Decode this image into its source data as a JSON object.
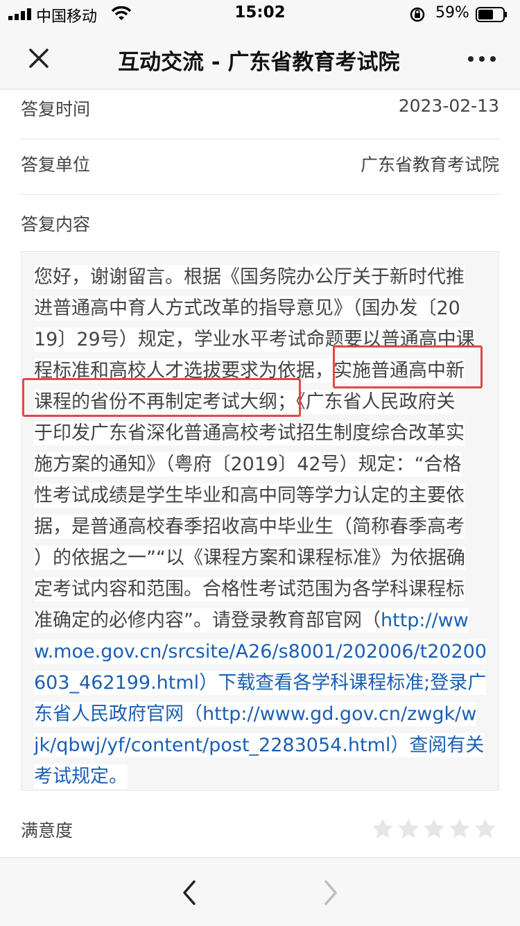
{
  "status_bar": {
    "carrier": "中国移动",
    "time": "15:02",
    "battery": "59%"
  },
  "nav": {
    "title": "互动交流 - 广东省教育考试院"
  },
  "reply": {
    "time_label": "答复时间",
    "time_value": "2023-02-13",
    "unit_label": "答复单位",
    "unit_value": "广东省教育考试院",
    "content_label": "答复内容",
    "lines": [
      [
        {
          "t": "您好，谢谢留言。根据《国务院办公厅关于新时代推"
        }
      ],
      [
        {
          "t": "进普通高中育人方式改革的指导意见》（国办发〔20"
        }
      ],
      [
        {
          "t": "19〕29号）规定，学业水平考试命题要以普通高中课"
        }
      ],
      [
        {
          "t": "程标准和高校人才选拔要求为依据，实施普通高中新"
        }
      ],
      [
        {
          "t": "课程的省份不再制定考试大纲；《广东省人民政府关"
        }
      ],
      [
        {
          "t": "于印发广东省深化普通高校考试招生制度综合改革实"
        }
      ],
      [
        {
          "t": "施方案的通知》（粤府〔2019〕42号）规定：“合格"
        }
      ],
      [
        {
          "t": "性考试成绩是学生毕业和高中同等学力认定的主要依"
        }
      ],
      [
        {
          "t": "据，是普通高校春季招收高中毕业生（简称春季高考"
        }
      ],
      [
        {
          "t": "）的依据之一”“以《课程方案和课程标准》为依据确"
        }
      ],
      [
        {
          "t": "定考试内容和范围。合格性考试范围为各学科课程标"
        }
      ],
      [
        {
          "t": "准确定的必修内容”。请登录教育部官网（"
        },
        {
          "t": "http://ww",
          "link": true
        }
      ],
      [
        {
          "t": "w.moe.gov.cn/srcsite/A26/s8001/202006/t20200",
          "link": true
        }
      ],
      [
        {
          "t": "603_462199.html）下载查看各学科课程标准;登录广",
          "link": true
        }
      ],
      [
        {
          "t": "东省人民政府官网（http://www.gd.gov.cn/zwgk/w",
          "link": true
        }
      ],
      [
        {
          "t": "jk/qbwj/yf/content/post_2283054.html）查阅有关",
          "link": true
        }
      ],
      [
        {
          "t": "考试规定。",
          "link": true
        }
      ]
    ]
  },
  "satisfaction": {
    "label": "满意度",
    "rating": 0,
    "max": 5
  },
  "colors": {
    "link": "#1a5fb4",
    "highlight": "#e04848",
    "star_empty": "#e6e6e6"
  }
}
